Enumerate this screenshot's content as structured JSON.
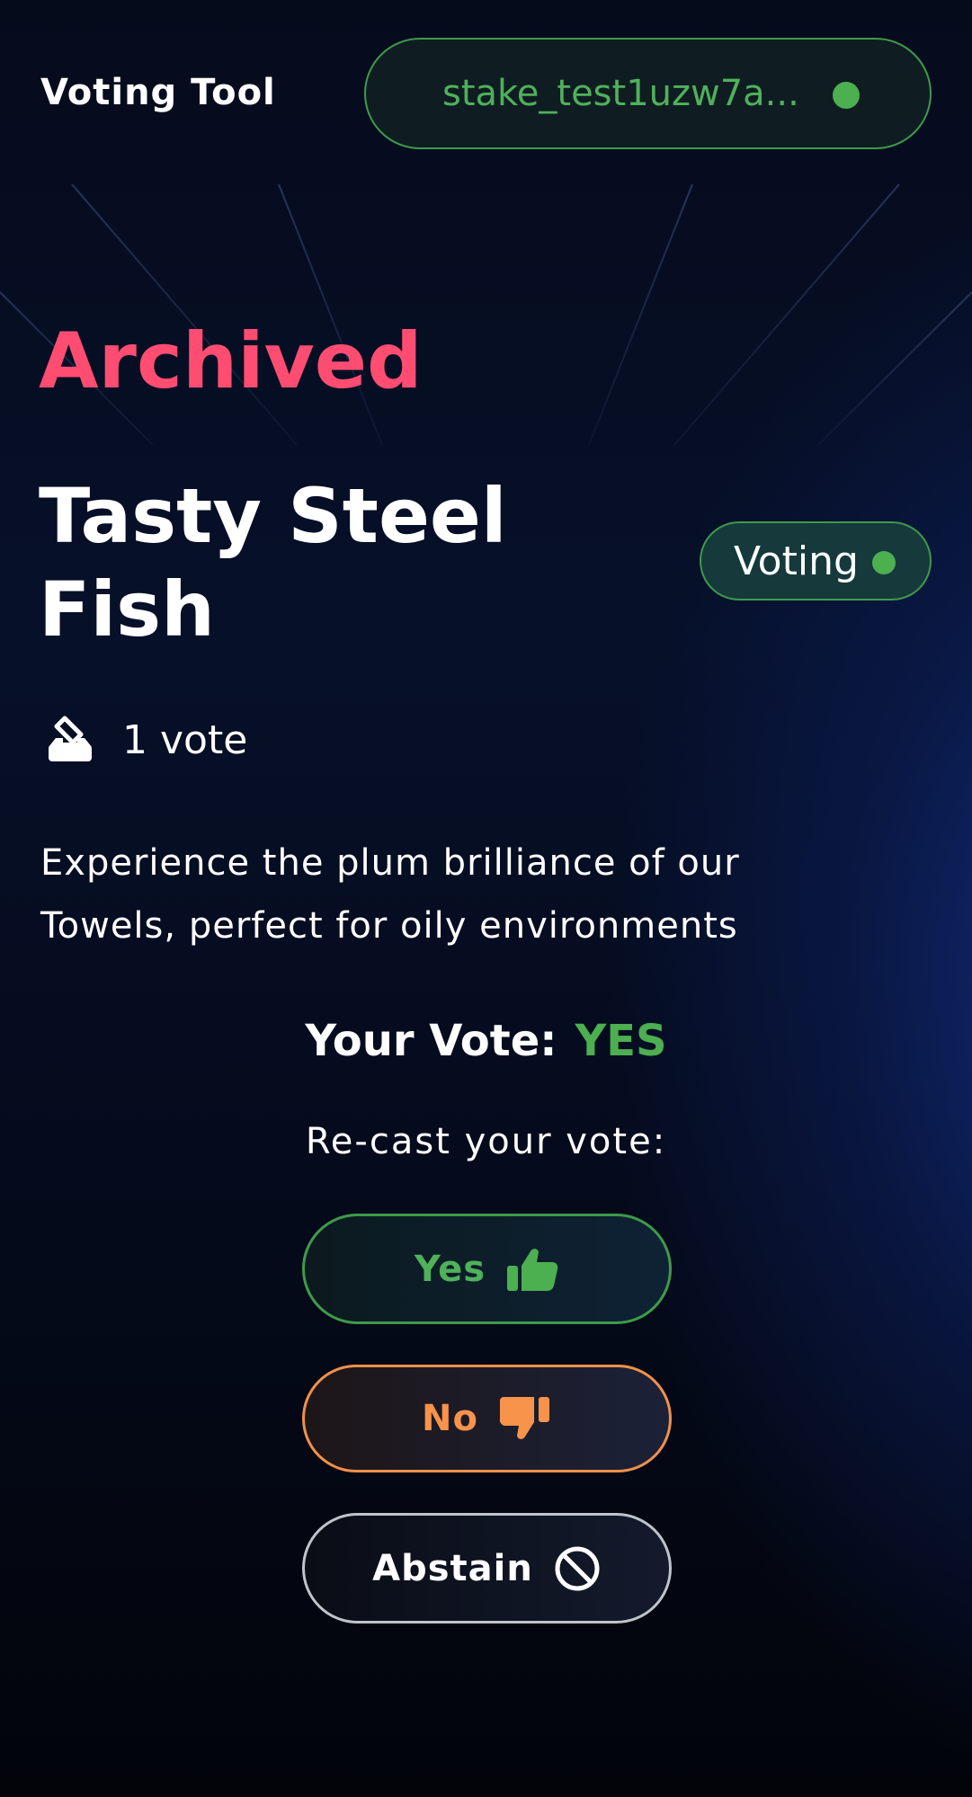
{
  "header": {
    "app_title": "Voting Tool",
    "wallet_address": "stake_test1uzw7a...",
    "wallet_status_color": "#4caf50"
  },
  "proposal": {
    "status": "Archived",
    "title": "Tasty Steel Fish",
    "phase": "Voting",
    "votes_count": "1 vote",
    "description": "Experience the plum brilliance of our Towels, perfect for oily environments"
  },
  "your_vote": {
    "label": "Your Vote:",
    "value": "YES"
  },
  "recast": {
    "label": "Re-cast your vote:",
    "options": [
      {
        "label": "Yes",
        "icon": "thumbs-up-icon",
        "color": "#4fb15a"
      },
      {
        "label": "No",
        "icon": "thumbs-down-icon",
        "color": "#f7934b"
      },
      {
        "label": "Abstain",
        "icon": "ban-icon",
        "color": "#ffffff"
      }
    ]
  },
  "colors": {
    "status_archived": "#ff4d72",
    "accent_green": "#4caf50",
    "accent_orange": "#f7934b"
  }
}
